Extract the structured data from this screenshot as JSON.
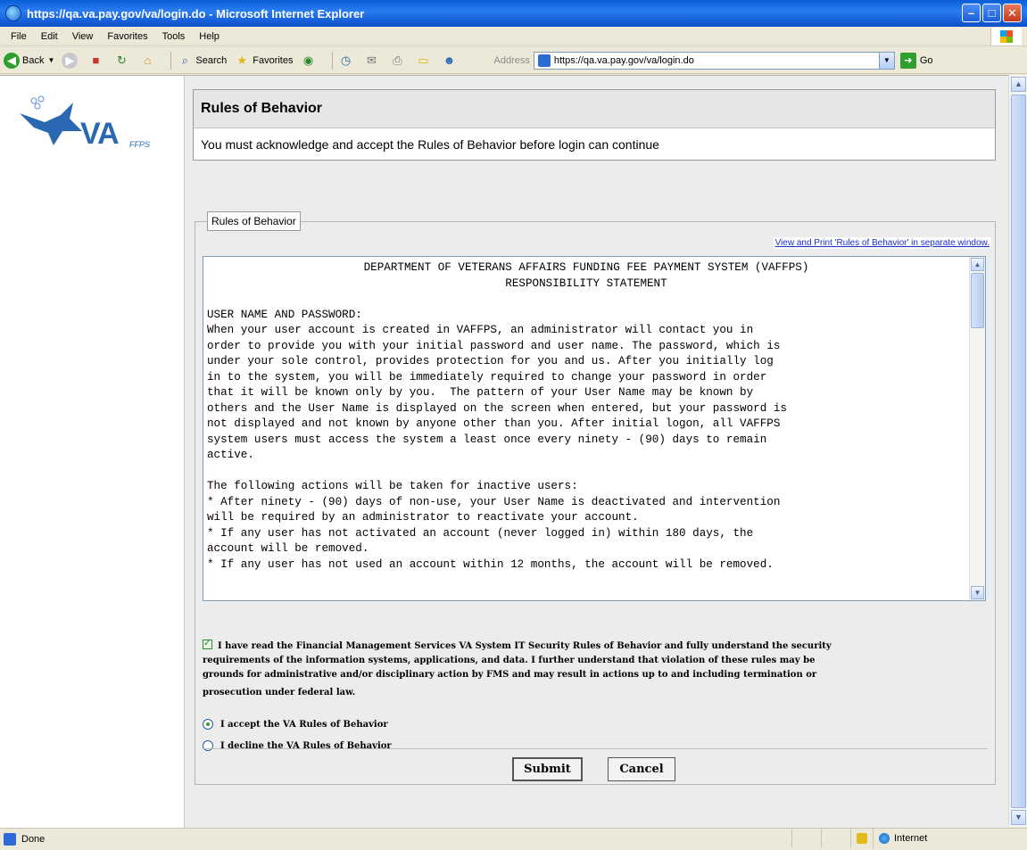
{
  "window": {
    "title": "https://qa.va.pay.gov/va/login.do - Microsoft Internet Explorer"
  },
  "menubar": {
    "items": [
      "File",
      "Edit",
      "View",
      "Favorites",
      "Tools",
      "Help"
    ]
  },
  "toolbar": {
    "back_label": "Back",
    "search_label": "Search",
    "favorites_label": "Favorites",
    "address_label": "Address",
    "address_value": "https://qa.va.pay.gov/va/login.do",
    "go_label": "Go"
  },
  "logo": {
    "text": "VA",
    "subtext": "FFPS"
  },
  "header": {
    "title": "Rules of Behavior",
    "subtitle": "You must acknowledge and accept the Rules of Behavior before login can continue"
  },
  "rules_panel": {
    "legend": "Rules of Behavior",
    "print_link": "View and Print 'Rules of Behavior' in separate window.",
    "heading_line1": "DEPARTMENT OF VETERANS AFFAIRS FUNDING FEE PAYMENT SYSTEM (VAFFPS)",
    "heading_line2": "RESPONSIBILITY STATEMENT",
    "body_lines": [
      "",
      "USER NAME AND PASSWORD:",
      "When your user account is created in VAFFPS, an administrator will contact you in",
      "order to provide you with your initial password and user name. The password, which is",
      "under your sole control, provides protection for you and us. After you initially log",
      "in to the system, you will be immediately required to change your password in order",
      "that it will be known only by you.  The pattern of your User Name may be known by",
      "others and the User Name is displayed on the screen when entered, but your password is",
      "not displayed and not known by anyone other than you. After initial logon, all VAFFPS",
      "system users must access the system a least once every ninety - (90) days to remain",
      "active.",
      "",
      "The following actions will be taken for inactive users:",
      "* After ninety - (90) days of non-use, your User Name is deactivated and intervention",
      "will be required by an administrator to reactivate your account.",
      "* If any user has not activated an account (never logged in) within 180 days, the",
      "account will be removed.",
      "* If any user has not used an account within 12 months, the account will be removed."
    ],
    "acknowledgement_lines": [
      "I have read the Financial Management Services VA System IT Security Rules of Behavior and fully understand the security",
      "requirements of the information systems, applications, and data. I further understand that violation of these rules may be",
      "grounds for administrative and/or disciplinary action by FMS and may result in actions up to and including termination or",
      "prosecution under federal law."
    ],
    "acknowledged": true,
    "accept_label": "I accept the VA Rules of Behavior",
    "decline_label": "I decline the VA Rules of Behavior",
    "selected_option": "accept",
    "submit_label": "Submit",
    "cancel_label": "Cancel"
  },
  "statusbar": {
    "status_text": "Done",
    "zone_text": "Internet"
  }
}
